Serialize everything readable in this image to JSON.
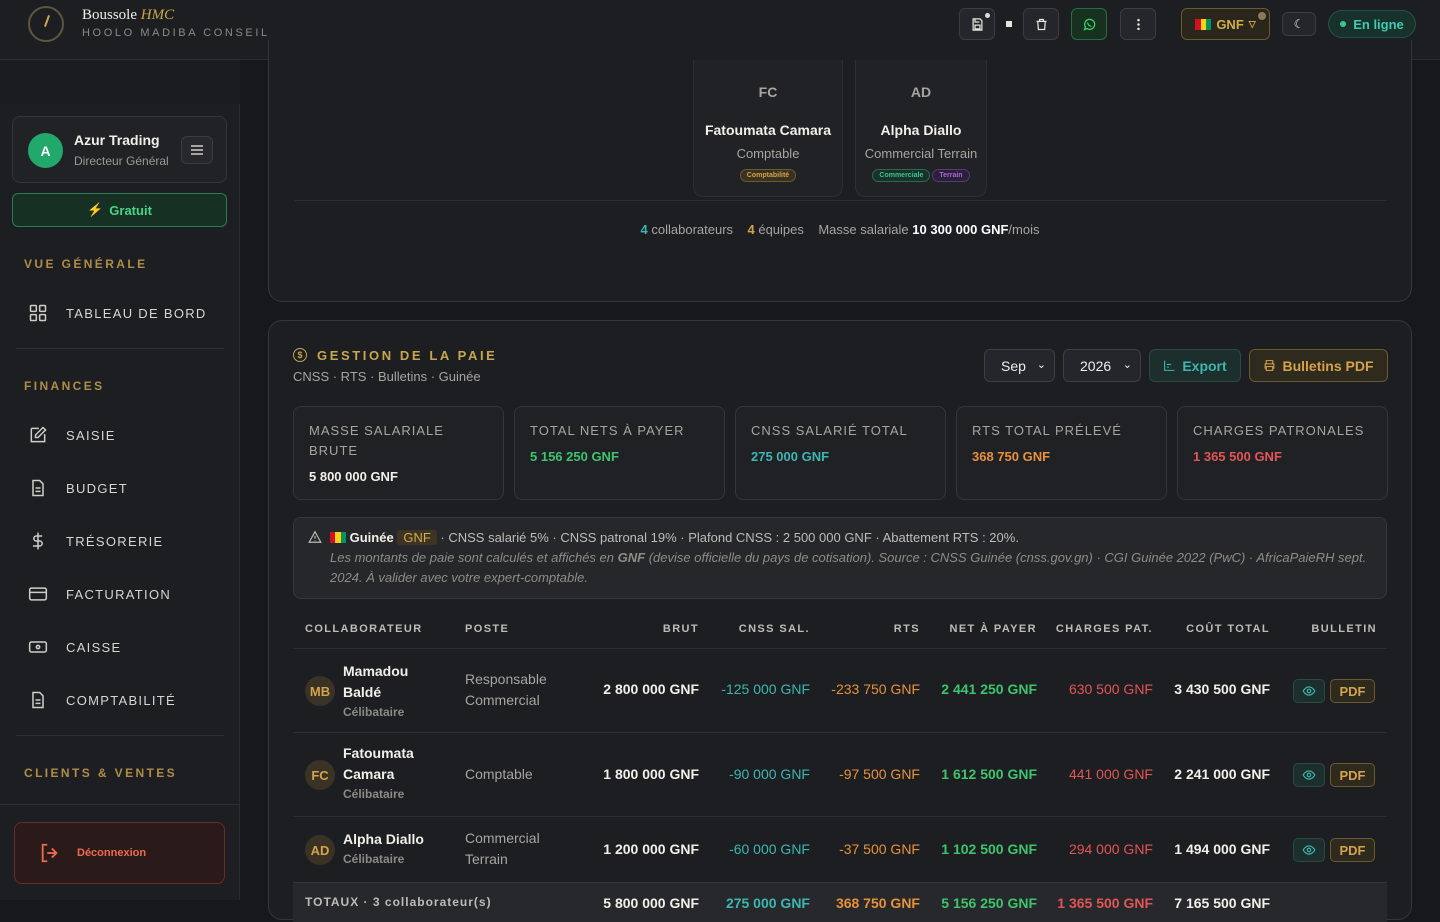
{
  "brand": {
    "name": "Boussole",
    "accent": "HMC",
    "subtitle": "HOOLO MADIBA CONSEIL"
  },
  "topbar": {
    "currency": "GNF",
    "status": "En ligne"
  },
  "profile": {
    "initial": "A",
    "company": "Azur Trading",
    "role": "Directeur Général"
  },
  "plan": "Gratuit",
  "nav": {
    "section_overview": "VUE GÉNÉRALE",
    "dashboard": "TABLEAU DE BORD",
    "section_finances": "FINANCES",
    "saisie": "SAISIE",
    "budget": "BUDGET",
    "tresorerie": "TRÉSORERIE",
    "facturation": "FACTURATION",
    "caisse": "CAISSE",
    "comptabilite": "COMPTABILITÉ",
    "section_clients": "CLIENTS & VENTES",
    "logout": "Déconnexion"
  },
  "team": {
    "cards": [
      {
        "initials": "FC",
        "name": "Fatoumata Camara",
        "role": "Comptable",
        "tags": [
          "Comptabilité"
        ]
      },
      {
        "initials": "AD",
        "name": "Alpha Diallo",
        "role": "Commercial Terrain",
        "tags": [
          "Commerciale",
          "Terrain"
        ]
      }
    ],
    "summary": {
      "collaborators_count": "4",
      "collaborators_label": "collaborateurs",
      "teams_count": "4",
      "teams_label": "équipes",
      "payroll_label": "Masse salariale",
      "payroll_value": "10 300 000 GNF",
      "payroll_suffix": "/mois"
    }
  },
  "payroll": {
    "title": "GESTION DE LA PAIE",
    "subtitle": "CNSS · RTS · Bulletins · Guinée",
    "month": "Sep",
    "year": "2026",
    "export_label": "Export",
    "bulletins_label": "Bulletins PDF",
    "kpis": [
      {
        "label": "MASSE SALARIALE BRUTE",
        "value": "5 800 000 GNF",
        "color": "#f2efe8"
      },
      {
        "label": "TOTAL NETS À PAYER",
        "value": "5 156 250 GNF",
        "color": "#3ec46d"
      },
      {
        "label": "CNSS SALARIÉ TOTAL",
        "value": "275 000 GNF",
        "color": "#3cb6b0"
      },
      {
        "label": "RTS TOTAL PRÉLEVÉ",
        "value": "368 750 GNF",
        "color": "#e8913a"
      },
      {
        "label": "CHARGES PATRONALES",
        "value": "1 365 500 GNF",
        "color": "#e25555"
      }
    ],
    "notice": {
      "country": "Guinée",
      "currency": "GNF",
      "rules": "· CNSS salarié 5% · CNSS patronal 19% · Plafond CNSS : 2 500 000 GNF · Abattement RTS : 20%.",
      "note_pre": "Les montants de paie sont calculés et affichés en",
      "note_currency": "GNF",
      "note_post": "(devise officielle du pays de cotisation). Source : CNSS Guinée (cnss.gov.gn) · CGI Guinée 2022 (PwC) · AfricaPaieRH sept. 2024. À valider avec votre expert-comptable."
    },
    "columns": [
      "COLLABORATEUR",
      "POSTE",
      "BRUT",
      "CNSS SAL.",
      "RTS",
      "NET À PAYER",
      "CHARGES PAT.",
      "COÛT TOTAL",
      "BULLETIN"
    ],
    "rows": [
      {
        "initials": "MB",
        "name1": "Mamadou",
        "name2": "Baldé",
        "status": "Célibataire",
        "poste1": "Responsable",
        "poste2": "Commercial",
        "brut": "2 800 000 GNF",
        "cnss": "-125 000 GNF",
        "rts": "-233 750 GNF",
        "net": "2 441 250 GNF",
        "charges": "630 500 GNF",
        "cout": "3 430 500 GNF"
      },
      {
        "initials": "FC",
        "name1": "Fatoumata",
        "name2": "Camara",
        "status": "Célibataire",
        "poste1": "Comptable",
        "poste2": "",
        "brut": "1 800 000 GNF",
        "cnss": "-90 000 GNF",
        "rts": "-97 500 GNF",
        "net": "1 612 500 GNF",
        "charges": "441 000 GNF",
        "cout": "2 241 000 GNF"
      },
      {
        "initials": "AD",
        "name1": "Alpha Diallo",
        "name2": "",
        "status": "Célibataire",
        "poste1": "Commercial",
        "poste2": "Terrain",
        "brut": "1 200 000 GNF",
        "cnss": "-60 000 GNF",
        "rts": "-37 500 GNF",
        "net": "1 102 500 GNF",
        "charges": "294 000 GNF",
        "cout": "1 494 000 GNF"
      }
    ],
    "pdf_label": "PDF",
    "totals": {
      "label": "TOTAUX · 3 collaborateur(s)",
      "brut": "5 800 000 GNF",
      "cnss": "275 000 GNF",
      "rts": "368 750 GNF",
      "net": "5 156 250 GNF",
      "charges": "1 365 500 GNF",
      "cout": "7 165 500 GNF"
    }
  },
  "colors": {
    "teal": "#3cb6b0",
    "orange": "#e8913a",
    "green": "#3ec46d",
    "red": "#e25555",
    "gold": "#c9a54e"
  }
}
